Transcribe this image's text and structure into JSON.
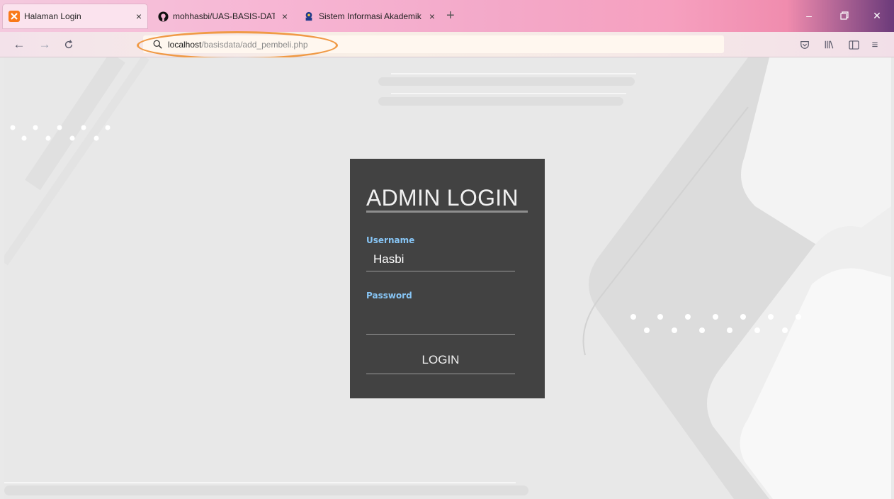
{
  "browser": {
    "tabs": [
      {
        "title": "Halaman Login",
        "icon": "xampp-icon",
        "active": true
      },
      {
        "title": "mohhasbi/UAS-BASIS-DATA-",
        "icon": "github-icon",
        "active": false
      },
      {
        "title": "Sistem Informasi Akademik",
        "icon": "campus-icon",
        "active": false
      }
    ],
    "url_host": "localhost",
    "url_path": "/basisdata/add_pembeli.php",
    "accent_ring_color": "#f09a46"
  },
  "login": {
    "title": "ADMIN LOGIN",
    "username_label": "Username",
    "username_value": "Hasbi",
    "password_label": "Password",
    "password_value": "",
    "submit_label": "LOGIN"
  }
}
